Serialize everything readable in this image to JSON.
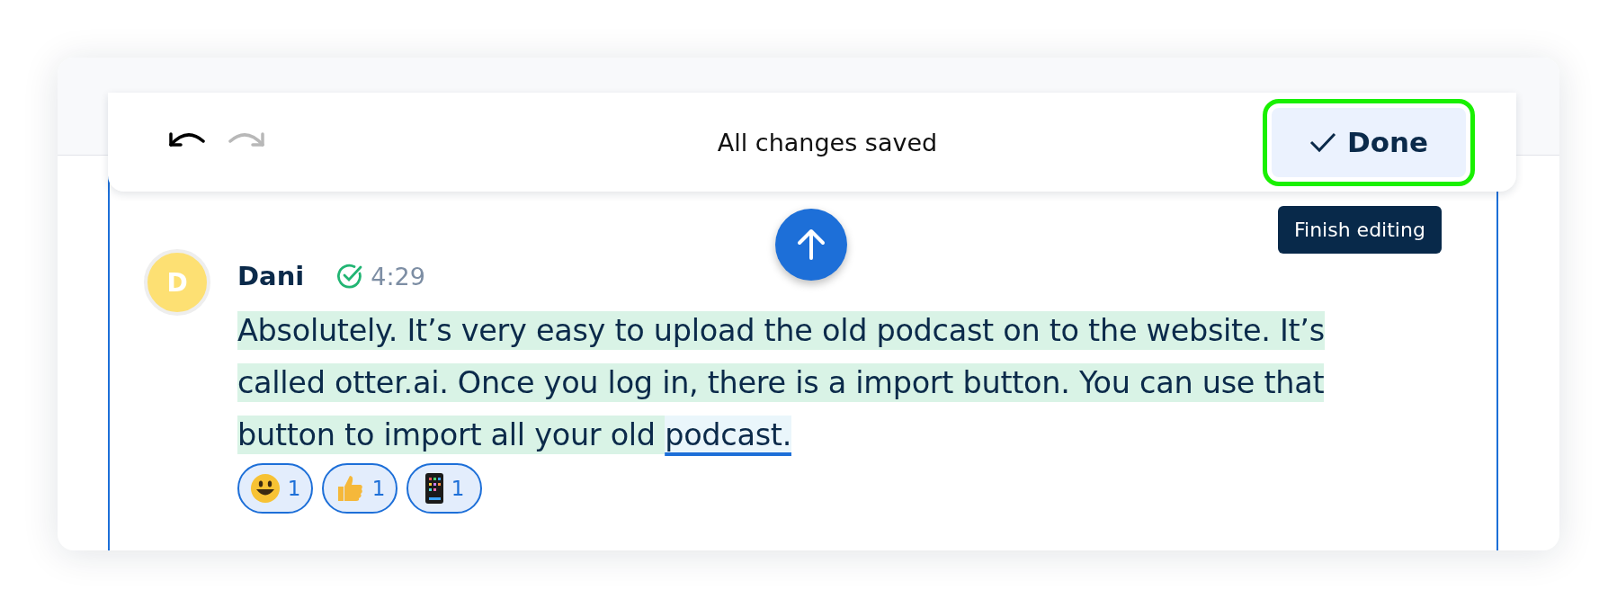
{
  "toolbar": {
    "undo": {
      "disabled": false
    },
    "redo": {
      "disabled": true
    },
    "status": "All changes saved",
    "done_button": {
      "label": "Done",
      "focused": true
    },
    "tooltip": "Finish editing"
  },
  "message": {
    "avatar_letter": "D",
    "speaker": "Dani",
    "verified": true,
    "time": "4:29",
    "segments": [
      {
        "text": "Absolutely. It’s very easy to upload the old podcast on to the website. It’s called otter.ai. Once you log in, there is a import button. You can use that button to import all your old ",
        "current": false
      },
      {
        "text": "podcast.",
        "current": true
      }
    ],
    "reactions": [
      {
        "kind": "smiley",
        "count": "1"
      },
      {
        "kind": "thumbs-up",
        "count": "1"
      },
      {
        "kind": "phone",
        "count": "1"
      }
    ]
  }
}
